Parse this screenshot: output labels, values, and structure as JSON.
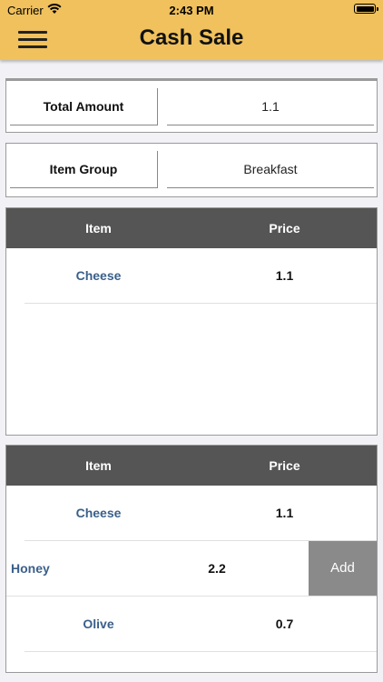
{
  "status_bar": {
    "carrier": "Carrier",
    "time": "2:43 PM"
  },
  "header": {
    "title": "Cash Sale",
    "menu_icon": "hamburger-menu-icon"
  },
  "total_amount": {
    "label": "Total Amount",
    "value": "1.1"
  },
  "item_group": {
    "label": "Item Group",
    "value": "Breakfast"
  },
  "cart_table": {
    "headers": [
      "Item",
      "Price"
    ],
    "rows": [
      {
        "item": "Cheese",
        "price": "1.1"
      }
    ]
  },
  "items_table": {
    "headers": [
      "Item",
      "Price"
    ],
    "rows": [
      {
        "item": "Cheese",
        "price": "1.1"
      },
      {
        "item": "Honey",
        "price": "2.2",
        "action": "Add"
      },
      {
        "item": "Olive",
        "price": "0.7"
      }
    ]
  }
}
